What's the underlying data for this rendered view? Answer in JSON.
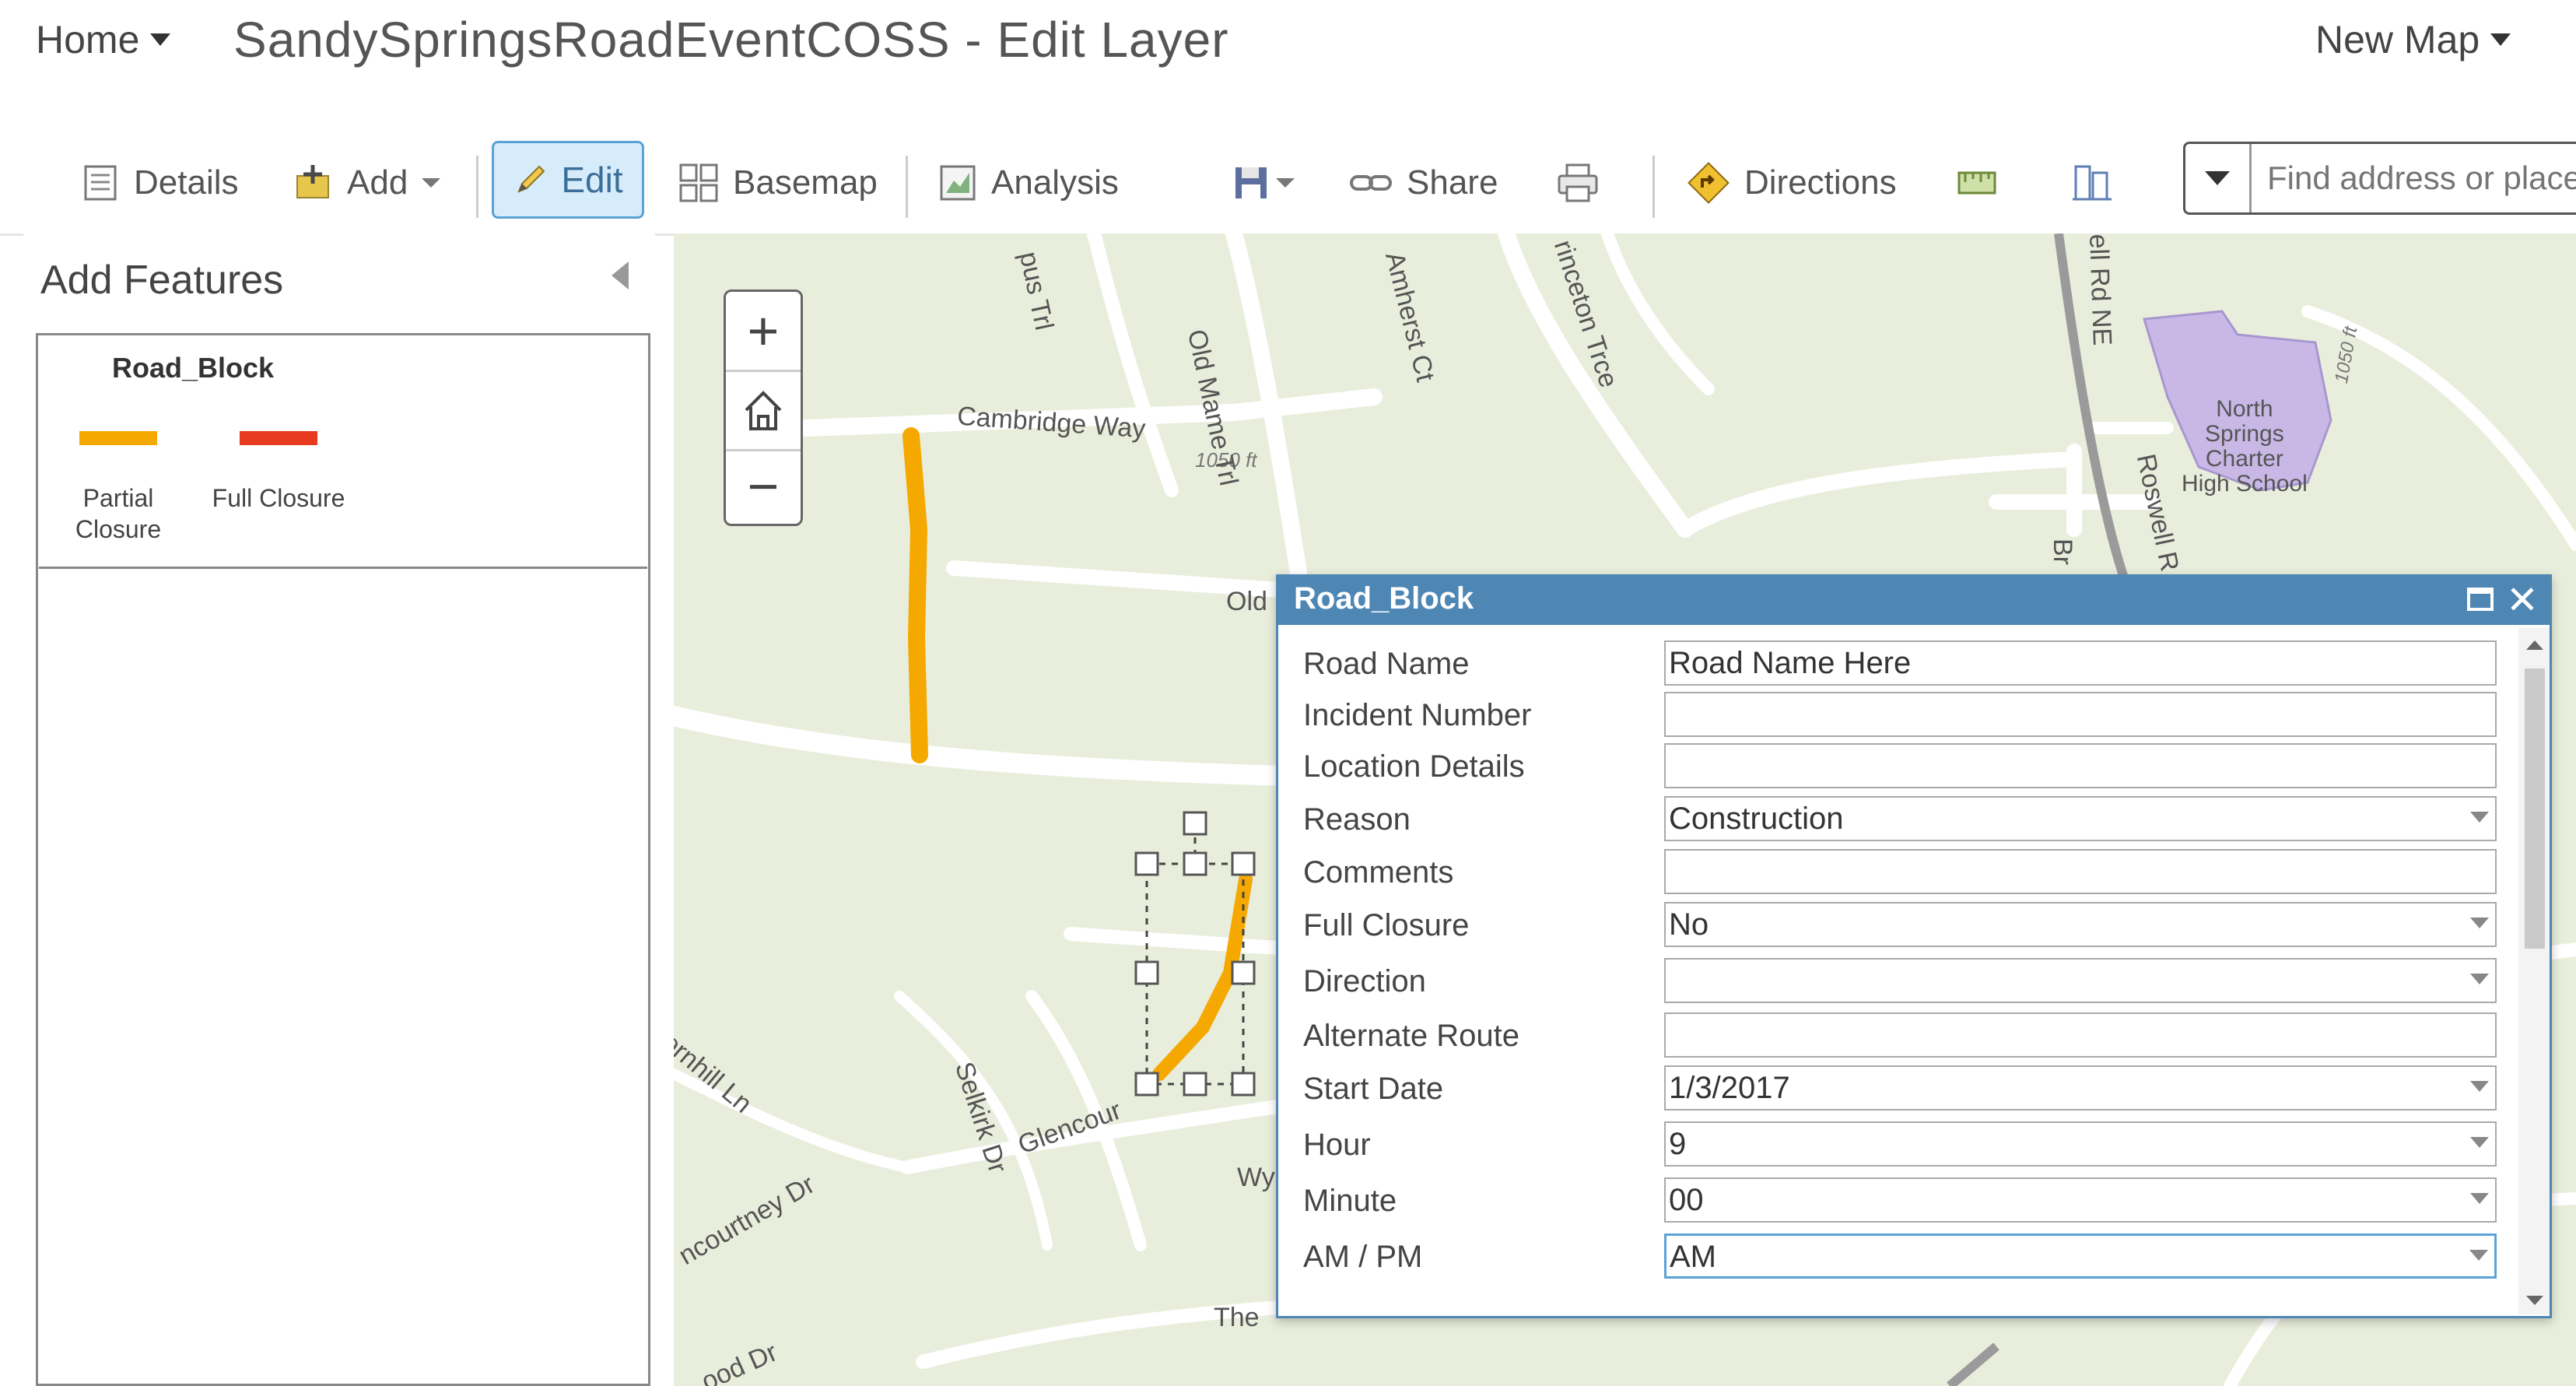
{
  "header": {
    "home_label": "Home",
    "title": "SandySpringsRoadEventCOSS - Edit Layer",
    "new_map_label": "New Map"
  },
  "toolbar": {
    "details": "Details",
    "add": "Add",
    "edit": "Edit",
    "basemap": "Basemap",
    "analysis": "Analysis",
    "share": "Share",
    "directions": "Directions",
    "search_placeholder": "Find address or place"
  },
  "panel": {
    "title": "Add Features",
    "layer_name": "Road_Block",
    "templates": [
      {
        "label_line1": "Partial",
        "label_line2": "Closure",
        "color": "#f5a800"
      },
      {
        "label_line1": "Full Closure",
        "label_line2": "",
        "color": "#e83a1e"
      }
    ]
  },
  "map": {
    "labels": {
      "cambridge": "Cambridge Way",
      "elev1": "1050 ft",
      "old": "Old",
      "old_mame": "Old Mame Trl",
      "amherst": "Amherst Ct",
      "princeton": "rinceton Trce",
      "roswell_ne": "ell Rd NE",
      "roswell": "Roswell R",
      "school": "North\nSprings\nCharter\nHigh School",
      "elev2": "1050 ft",
      "br": "Br",
      "pus_trl": "pus Trl",
      "hornhill": "ornhill Ln",
      "selkirk": "Selkirk Dr",
      "glencourt": "Glencour",
      "wy": "Wy",
      "courtney": "ncourtney Dr",
      "the": "The",
      "ood": "ood Dr"
    },
    "colors": {
      "partial_closure": "#f5a800",
      "full_closure": "#e83a1e",
      "school": "#c9b8e6"
    }
  },
  "popup": {
    "title": "Road_Block",
    "fields": [
      {
        "label": "Road Name",
        "value": "Road Name Here",
        "dropdown": false
      },
      {
        "label": "Incident Number",
        "value": "",
        "dropdown": false
      },
      {
        "label": "Location Details",
        "value": "",
        "dropdown": false
      },
      {
        "label": "Reason",
        "value": "Construction",
        "dropdown": true
      },
      {
        "label": "Comments",
        "value": "",
        "dropdown": false
      },
      {
        "label": "Full Closure",
        "value": "No",
        "dropdown": true
      },
      {
        "label": "Direction",
        "value": "",
        "dropdown": true
      },
      {
        "label": "Alternate Route",
        "value": "",
        "dropdown": false
      },
      {
        "label": "Start Date",
        "value": "1/3/2017",
        "dropdown": true
      },
      {
        "label": "Hour",
        "value": "9",
        "dropdown": true
      },
      {
        "label": "Minute",
        "value": "00",
        "dropdown": true
      },
      {
        "label": "AM / PM",
        "value": "AM",
        "dropdown": true
      }
    ]
  }
}
